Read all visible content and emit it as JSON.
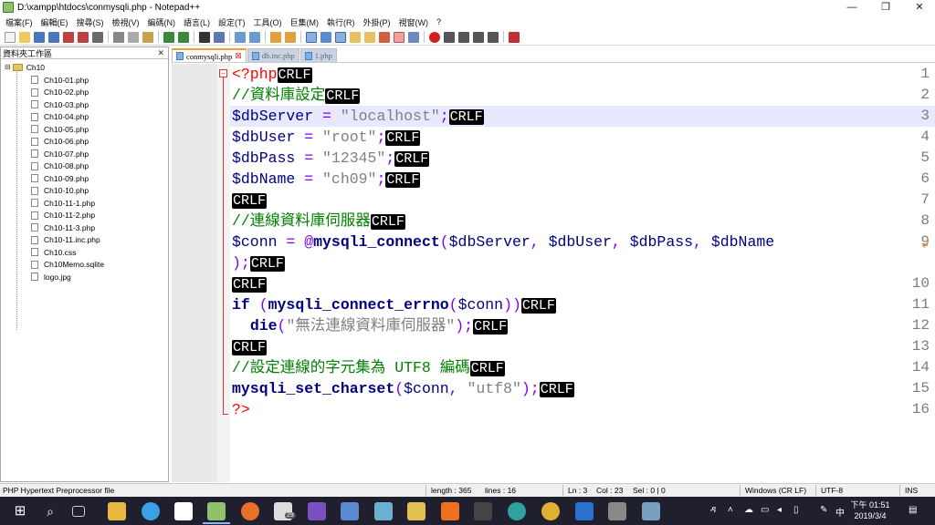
{
  "window": {
    "title": "D:\\xampp\\htdocs\\conmysqli.php - Notepad++",
    "min": "—",
    "max": "❐",
    "close": "✕"
  },
  "menus": [
    "檔案(F)",
    "編輯(E)",
    "搜尋(S)",
    "檢視(V)",
    "編碼(N)",
    "語言(L)",
    "設定(T)",
    "工具(O)",
    "巨集(M)",
    "執行(R)",
    "外掛(P)",
    "視窗(W)",
    "?"
  ],
  "panel": {
    "title": "資料夾工作區",
    "close": "✕",
    "root": "Ch10",
    "files": [
      "Ch10-01.php",
      "Ch10-02.php",
      "Ch10-03.php",
      "Ch10-04.php",
      "Ch10-05.php",
      "Ch10-06.php",
      "Ch10-07.php",
      "Ch10-08.php",
      "Ch10-09.php",
      "Ch10-10.php",
      "Ch10-11-1.php",
      "Ch10-11-2.php",
      "Ch10-11-3.php",
      "Ch10-11.inc.php",
      "Ch10.css",
      "Ch10Memo.sqlite",
      "logo.jpg"
    ]
  },
  "tabs": [
    {
      "label": "conmysqli.php",
      "active": true
    },
    {
      "label": "db.inc.php",
      "active": false
    },
    {
      "label": "1.php",
      "active": false
    }
  ],
  "editor": {
    "line_numbers": [
      "1",
      "2",
      "3",
      "4",
      "5",
      "6",
      "7",
      "8",
      "9",
      "",
      "10",
      "11",
      "12",
      "13",
      "14",
      "15",
      "16"
    ],
    "crlf": "CRLF"
  },
  "code": {
    "l1": "<?php",
    "l2": "//資料庫設定",
    "l3a": "$dbServer",
    "l3b": " = ",
    "l3c": "\"localhost\"",
    "l3d": ";",
    "l4a": "$dbUser",
    "l4b": " = ",
    "l4c": "\"root\"",
    "l4d": ";",
    "l5a": "$dbPass",
    "l5b": " = ",
    "l5c": "\"12345\"",
    "l5d": ";",
    "l6a": "$dbName",
    "l6b": " = ",
    "l6c": "\"ch09\"",
    "l6d": ";",
    "l8": "//連線資料庫伺服器",
    "l9a": "$conn",
    "l9b": " = @",
    "l9c": "mysqli_connect",
    "l9d": "(",
    "l9e": "$dbServer",
    "l9f": ", ",
    "l9g": "$dbUser",
    "l9h": ", ",
    "l9i": "$dbPass",
    "l9j": ", ",
    "l9k": "$dbName",
    "l9w": ");",
    "l11a": "if",
    "l11b": " (",
    "l11c": "mysqli_connect_errno",
    "l11d": "(",
    "l11e": "$conn",
    "l11f": "))",
    "l12a": "  ",
    "l12b": "die",
    "l12c": "(",
    "l12d": "\"無法連線資料庫伺服器\"",
    "l12e": ");",
    "l14": "//設定連線的字元集為 UTF8 編碼",
    "l15a": "mysqli_set_charset",
    "l15b": "(",
    "l15c": "$conn",
    "l15d": ", ",
    "l15e": "\"utf8\"",
    "l15f": ");",
    "l16": "?>"
  },
  "status": {
    "filetype": "PHP Hypertext Preprocessor file",
    "length": "length : 365",
    "lines": "lines : 16",
    "ln": "Ln : 3",
    "col": "Col : 23",
    "sel": "Sel : 0 | 0",
    "eol": "Windows (CR LF)",
    "enc": "UTF-8",
    "mode": "INS"
  },
  "taskbar": {
    "time": "下午 01:51",
    "date": "2019/3/4",
    "ime": "中",
    "badge": "29"
  }
}
